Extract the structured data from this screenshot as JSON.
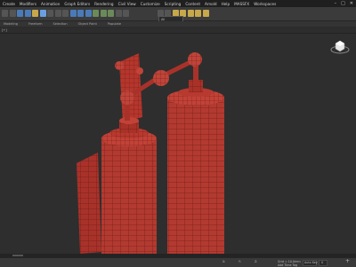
{
  "app": {
    "menu": [
      "Create",
      "Modifiers",
      "Animation",
      "Graph Editors",
      "Rendering",
      "Civil View",
      "Customize",
      "Scripting",
      "Content",
      "Arnold",
      "Help",
      "MASSFX",
      "Workspaces"
    ],
    "window_controls": [
      "–",
      "□",
      "✕"
    ]
  },
  "toolbar": {
    "selection_filter": "All",
    "icons": [
      "undo-icon",
      "redo-icon",
      "link-icon",
      "unlink-icon",
      "bind-icon",
      "select-icon",
      "select-by-name-icon",
      "rect-region-icon",
      "window-crossing-icon",
      "move-icon",
      "rotate-icon",
      "scale-icon",
      "snap-icon",
      "angle-snap-icon",
      "percent-snap-icon",
      "mirror-icon",
      "align-icon",
      "layer-icon",
      "curve-editor-icon",
      "schematic-icon",
      "material-editor-icon",
      "render-setup-icon",
      "render-frame-icon",
      "render-icon"
    ]
  },
  "ribbon": {
    "tabs": [
      "Modeling",
      "Freeform",
      "Selection",
      "Object Paint",
      "Populate"
    ]
  },
  "viewport": {
    "label": "[+]",
    "background": "#2e2e2e",
    "model_color": "#b8382e"
  },
  "status": {
    "left": "",
    "coords": [
      "X:",
      "Y:",
      "Z:"
    ],
    "grid": "Grid = 10.0mm",
    "time_tag": "Add Time Tag",
    "auto_key": "Auto Key",
    "frame": "0"
  },
  "colors": {
    "accent": "#4a7ab8",
    "red_model": "#b8382e",
    "wire": "#5a1510"
  }
}
